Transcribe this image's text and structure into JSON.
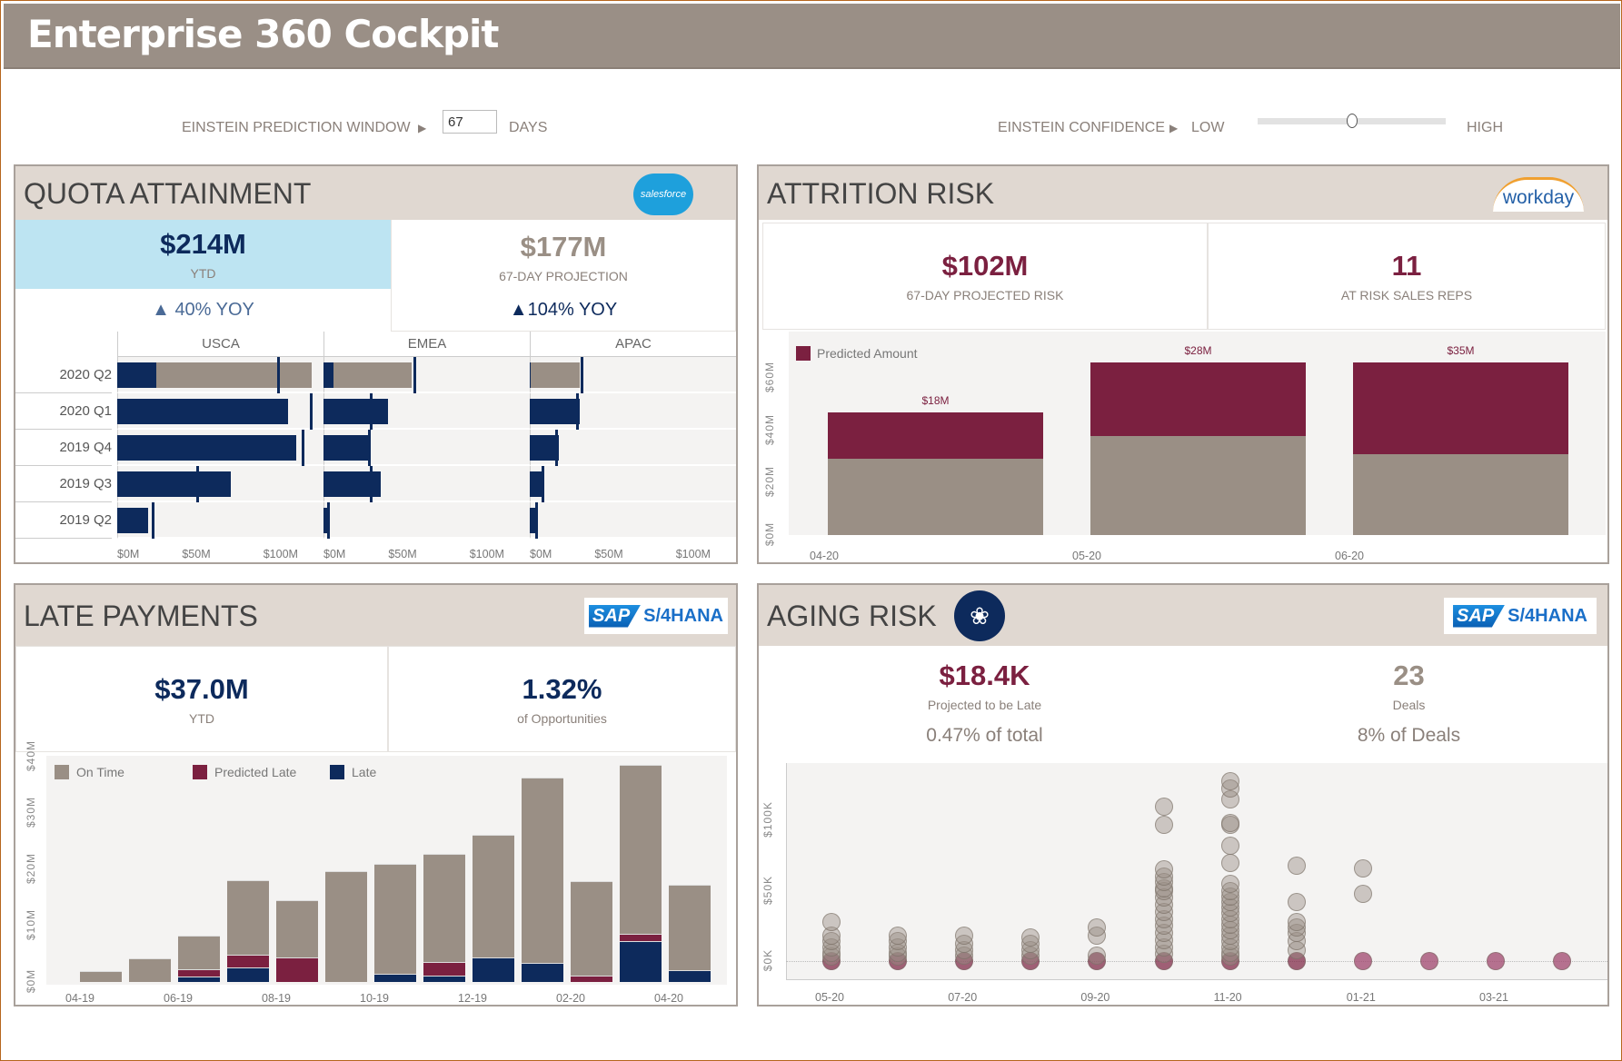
{
  "header": {
    "title": "Enterprise 360 Cockpit"
  },
  "controls": {
    "prediction_label": "EINSTEIN PREDICTION WINDOW",
    "prediction_value": "67",
    "prediction_unit": "DAYS",
    "confidence_label": "EINSTEIN CONFIDENCE",
    "confidence_low": "LOW",
    "confidence_high": "HIGH",
    "confidence_level": 0.5,
    "arrow_icon": "play-triangle-icon"
  },
  "colors": {
    "navy": "#0d2a5c",
    "maroon": "#7b2040",
    "gray": "#9a8f85",
    "header": "#9a8f86",
    "panel_header": "#e0d8d1",
    "highlight": "#bde4f2"
  },
  "quota": {
    "title": "QUOTA ATTAINMENT",
    "logo": "salesforce",
    "ytd_value": "$214M",
    "ytd_label": "YTD",
    "ytd_yoy": "40% YOY",
    "proj_value": "$177M",
    "proj_label": "67-DAY PROJECTION",
    "proj_yoy": "104% YOY",
    "regions": [
      "USCA",
      "EMEA",
      "APAC"
    ],
    "quarters": [
      "2020 Q2",
      "2020 Q1",
      "2019 Q4",
      "2019 Q3",
      "2019 Q2"
    ],
    "axis_ticks": [
      "$0M",
      "$50M",
      "$100M"
    ]
  },
  "attrition": {
    "title": "ATTRITION RISK",
    "logo": "workday",
    "risk_value": "$102M",
    "risk_label": "67-DAY PROJECTED RISK",
    "reps_value": "11",
    "reps_label": "AT RISK SALES REPS"
  },
  "late": {
    "title": "LATE PAYMENTS",
    "logo": "SAP S/4HANA",
    "ytd_value": "$37.0M",
    "ytd_label": "YTD",
    "pct_value": "1.32%",
    "pct_label": "of Opportunities"
  },
  "aging": {
    "title": "AGING RISK",
    "logo": "SAP S/4HANA",
    "icon": "einstein-badge-icon",
    "late_value": "$18.4K",
    "late_label": "Projected to be Late",
    "late_pct": "0.47% of total",
    "deals_value": "23",
    "deals_label": "Deals",
    "deals_pct": "8%  of Deals"
  },
  "logos": {
    "salesforce": "salesforce",
    "workday": "workday",
    "sap": "SAP",
    "s4": "S/4HANA"
  },
  "chart_data": [
    {
      "type": "bar",
      "name": "quota-attainment",
      "orientation": "horizontal",
      "facets": [
        "USCA",
        "EMEA",
        "APAC"
      ],
      "categories": [
        "2020 Q2",
        "2020 Q1",
        "2019 Q4",
        "2019 Q3",
        "2019 Q2"
      ],
      "xlim": [
        0,
        127
      ],
      "xticks": [
        "$0M",
        "$50M",
        "$100M"
      ],
      "series": [
        {
          "name": "Actual",
          "values": {
            "USCA": [
              24,
              105,
              110,
              70,
              19
            ],
            "EMEA": [
              6,
              40,
              29,
              35,
              4
            ],
            "APAC": [
              0.5,
              31,
              18,
              9,
              4
            ]
          }
        },
        {
          "name": "Projection",
          "values": {
            "USCA": [
              120,
              0,
              0,
              0,
              0
            ],
            "EMEA": [
              54,
              0,
              0,
              0,
              0
            ],
            "APAC": [
              31,
              0,
              0,
              0,
              0
            ]
          }
        },
        {
          "name": "Target",
          "values": {
            "USCA": [
              99,
              119,
              114,
              49,
              22
            ],
            "EMEA": [
              56,
              29,
              28,
              29,
              3
            ],
            "APAC": [
              32,
              29,
              16,
              8,
              4
            ]
          }
        }
      ]
    },
    {
      "type": "bar",
      "name": "attrition-risk",
      "stacked": true,
      "categories": [
        "04-20",
        "05-20",
        "06-20"
      ],
      "ylim": [
        0,
        75
      ],
      "yticks": [
        "$0M",
        "$20M",
        "$40M",
        "$60M"
      ],
      "legend": [
        "Predicted Amount"
      ],
      "series": [
        {
          "values": [
            29,
            38,
            31
          ]
        },
        {
          "name": "Predicted Amount",
          "values": [
            18,
            28,
            35
          ]
        }
      ],
      "labels": [
        "$18M",
        "$28M",
        "$35M"
      ]
    },
    {
      "type": "bar",
      "name": "late-payments",
      "stacked": true,
      "categories": [
        "04-19",
        "05-19",
        "06-19",
        "07-19",
        "08-19",
        "09-19",
        "10-19",
        "11-19",
        "12-19",
        "01-20",
        "02-20",
        "03-20",
        "04-20"
      ],
      "xticks": [
        "04-19",
        "06-19",
        "08-19",
        "10-19",
        "12-19",
        "02-20",
        "04-20"
      ],
      "ylim": [
        0,
        40.2
      ],
      "yticks": [
        "$0M",
        "$10M",
        "$20M",
        "$30M",
        "$40M"
      ],
      "legend_position": "top-left",
      "series": [
        {
          "name": "Late",
          "values": [
            0,
            0,
            1.0,
            2.6,
            0,
            0,
            1.4,
            1.2,
            4.3,
            3.4,
            0,
            7.3,
            2.1
          ]
        },
        {
          "name": "Predicted Late",
          "values": [
            0,
            0,
            1.2,
            2.2,
            4.3,
            0,
            0,
            2.4,
            0,
            0,
            1.2,
            1.2,
            0
          ]
        },
        {
          "name": "On Time",
          "values": [
            2.0,
            4.2,
            6.1,
            13.3,
            10.2,
            19.7,
            19.6,
            19.2,
            21.8,
            33.0,
            16.7,
            30.1,
            15.1
          ]
        }
      ]
    },
    {
      "type": "scatter",
      "name": "aging-risk",
      "categories": [
        "05-20",
        "06-20",
        "07-20",
        "08-20",
        "09-20",
        "10-20",
        "11-20",
        "12-20",
        "01-21",
        "02-21",
        "03-21",
        "04-21"
      ],
      "xticks": [
        "05-20",
        "07-20",
        "09-20",
        "11-20",
        "01-21",
        "03-21"
      ],
      "ylim": [
        -13.6,
        141
      ],
      "yticks": [
        "$0K",
        "$50K",
        "$100K"
      ],
      "points_k": [
        [
          0,
          3,
          6,
          10,
          14,
          18,
          28
        ],
        [
          0,
          3,
          6,
          10,
          14,
          18
        ],
        [
          0,
          4,
          8,
          12,
          18
        ],
        [
          0,
          4,
          8,
          12,
          17
        ],
        [
          0,
          4,
          18,
          24
        ],
        [
          0,
          5,
          10,
          15,
          20,
          25,
          30,
          35,
          40,
          45,
          50,
          52,
          56,
          60,
          65,
          97,
          110
        ],
        [
          0,
          3,
          6,
          10,
          14,
          18,
          22,
          26,
          30,
          34,
          38,
          42,
          46,
          50,
          55,
          70,
          82,
          97,
          98,
          115,
          123,
          128
        ],
        [
          0,
          8,
          14,
          20,
          24,
          28,
          42,
          68
        ],
        [
          0,
          48,
          66
        ],
        [
          0
        ],
        [
          0
        ],
        [
          0
        ]
      ]
    }
  ]
}
